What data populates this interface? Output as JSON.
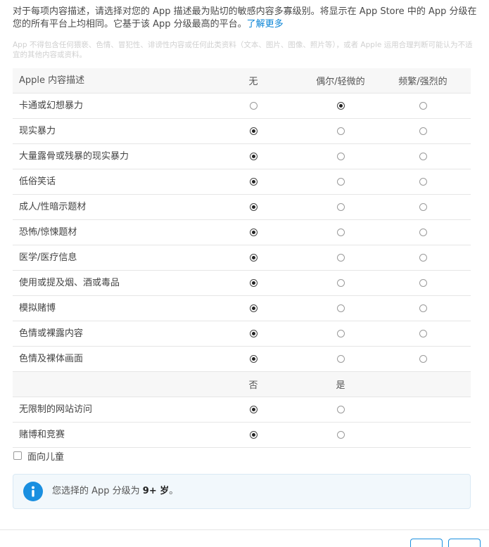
{
  "intro": {
    "text": "对于每项内容描述，请选择对您的 App 描述最为贴切的敏感内容多寡级别。将显示在 App Store 中的 App 分级在您的所有平台上均相同。它基于该 App 分级最高的平台。",
    "link": "了解更多"
  },
  "note": "App 不得包含任何猥亵、色情、冒犯性、诽谤性内容或任何此类资料（文本、图片、图像、照片等），或者 Apple 运用合理判断可能认为不适宜的其他内容或资料。",
  "table": {
    "header": [
      "Apple 内容描述",
      "无",
      "偶尔/轻微的",
      "频繁/强烈的"
    ],
    "rows": [
      {
        "label": "卡通或幻想暴力",
        "selected": 1
      },
      {
        "label": "现实暴力",
        "selected": 0
      },
      {
        "label": "大量露骨或残暴的现实暴力",
        "selected": 0
      },
      {
        "label": "低俗笑话",
        "selected": 0
      },
      {
        "label": "成人/性暗示题材",
        "selected": 0
      },
      {
        "label": "恐怖/惊悚题材",
        "selected": 0
      },
      {
        "label": "医学/医疗信息",
        "selected": 0
      },
      {
        "label": "使用或提及烟、酒或毒品",
        "selected": 0
      },
      {
        "label": "模拟赌博",
        "selected": 0
      },
      {
        "label": "色情或裸露内容",
        "selected": 0
      },
      {
        "label": "色情及裸体画面",
        "selected": 0
      }
    ],
    "subheader": [
      "否",
      "是"
    ],
    "binary_rows": [
      {
        "label": "无限制的网站访问",
        "selected": 0
      },
      {
        "label": "赌博和竞赛",
        "selected": 0
      }
    ]
  },
  "kids": {
    "label": "面向儿童",
    "checked": false
  },
  "info": {
    "prefix": "您选择的 App 分级为 ",
    "rating": "9+ 岁",
    "suffix": "。",
    "icon": "info-icon",
    "color": "#1a8fe0"
  }
}
